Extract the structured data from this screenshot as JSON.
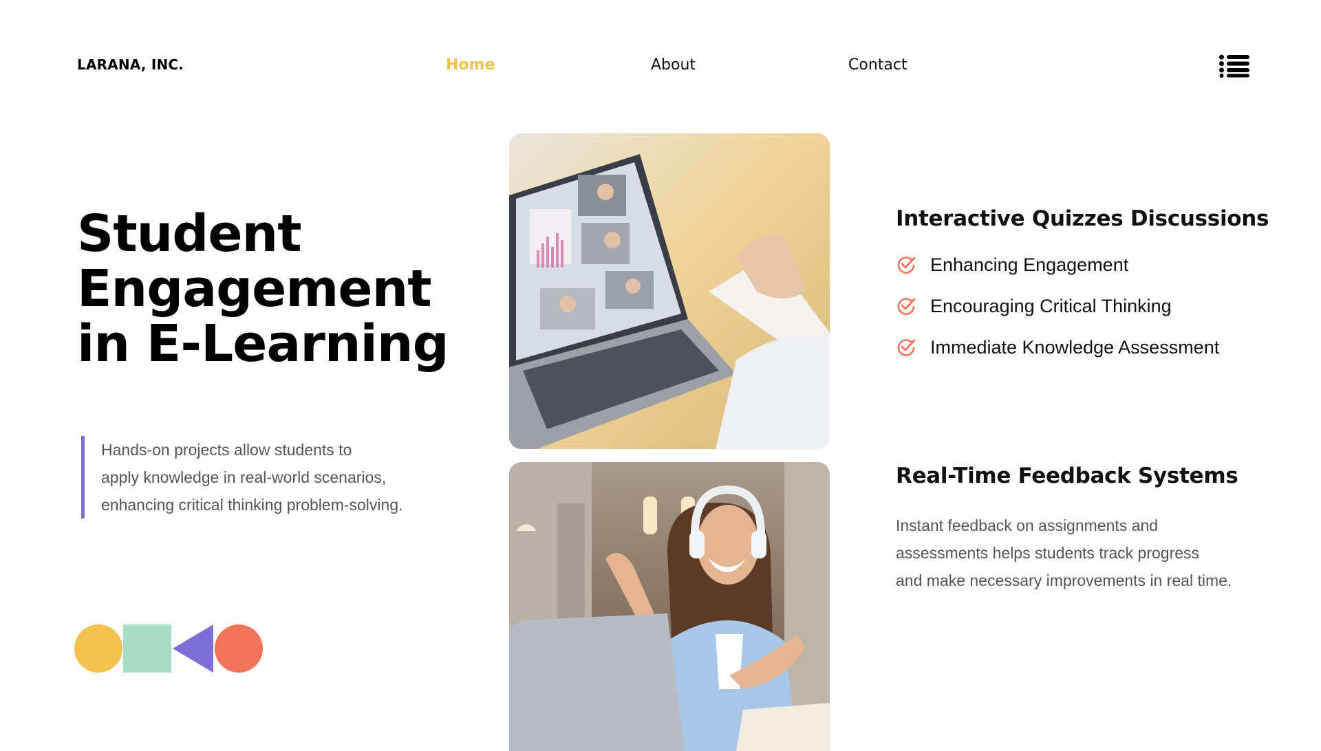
{
  "header": {
    "brand": "LARANA, INC.",
    "nav": [
      {
        "label": "Home",
        "active": true
      },
      {
        "label": "About",
        "active": false
      },
      {
        "label": "Contact",
        "active": false
      }
    ],
    "menu_icon": "hamburger-list-icon"
  },
  "hero": {
    "title_lines": [
      "Student",
      "Engagement",
      "in E-Learning"
    ],
    "quote_lines": [
      "Hands-on projects allow students to",
      "apply knowledge in real-world scenarios,",
      "enhancing critical thinking  problem-solving."
    ],
    "shapes": [
      "yellow-circle",
      "mint-square",
      "purple-triangle",
      "coral-circle"
    ]
  },
  "photos": {
    "top": "laptop-video-conference-photo",
    "bottom": "woman-headphones-laptop-photo"
  },
  "section1": {
    "title": "Interactive Quizzes Discussions",
    "items": [
      "Enhancing Engagement",
      "Encouraging Critical Thinking",
      "Immediate Knowledge Assessment"
    ],
    "item_icon": "check-circle-icon"
  },
  "section2": {
    "title": "Real-Time Feedback Systems",
    "desc_lines": [
      "Instant feedback on assignments and",
      "assessments helps students track progress",
      "and make necessary improvements in real time."
    ]
  },
  "colors": {
    "accent_yellow": "#F2C14E",
    "mint": "#A8DCC6",
    "purple": "#7E6FD8",
    "coral": "#F2735A",
    "text_gray": "#555555"
  }
}
